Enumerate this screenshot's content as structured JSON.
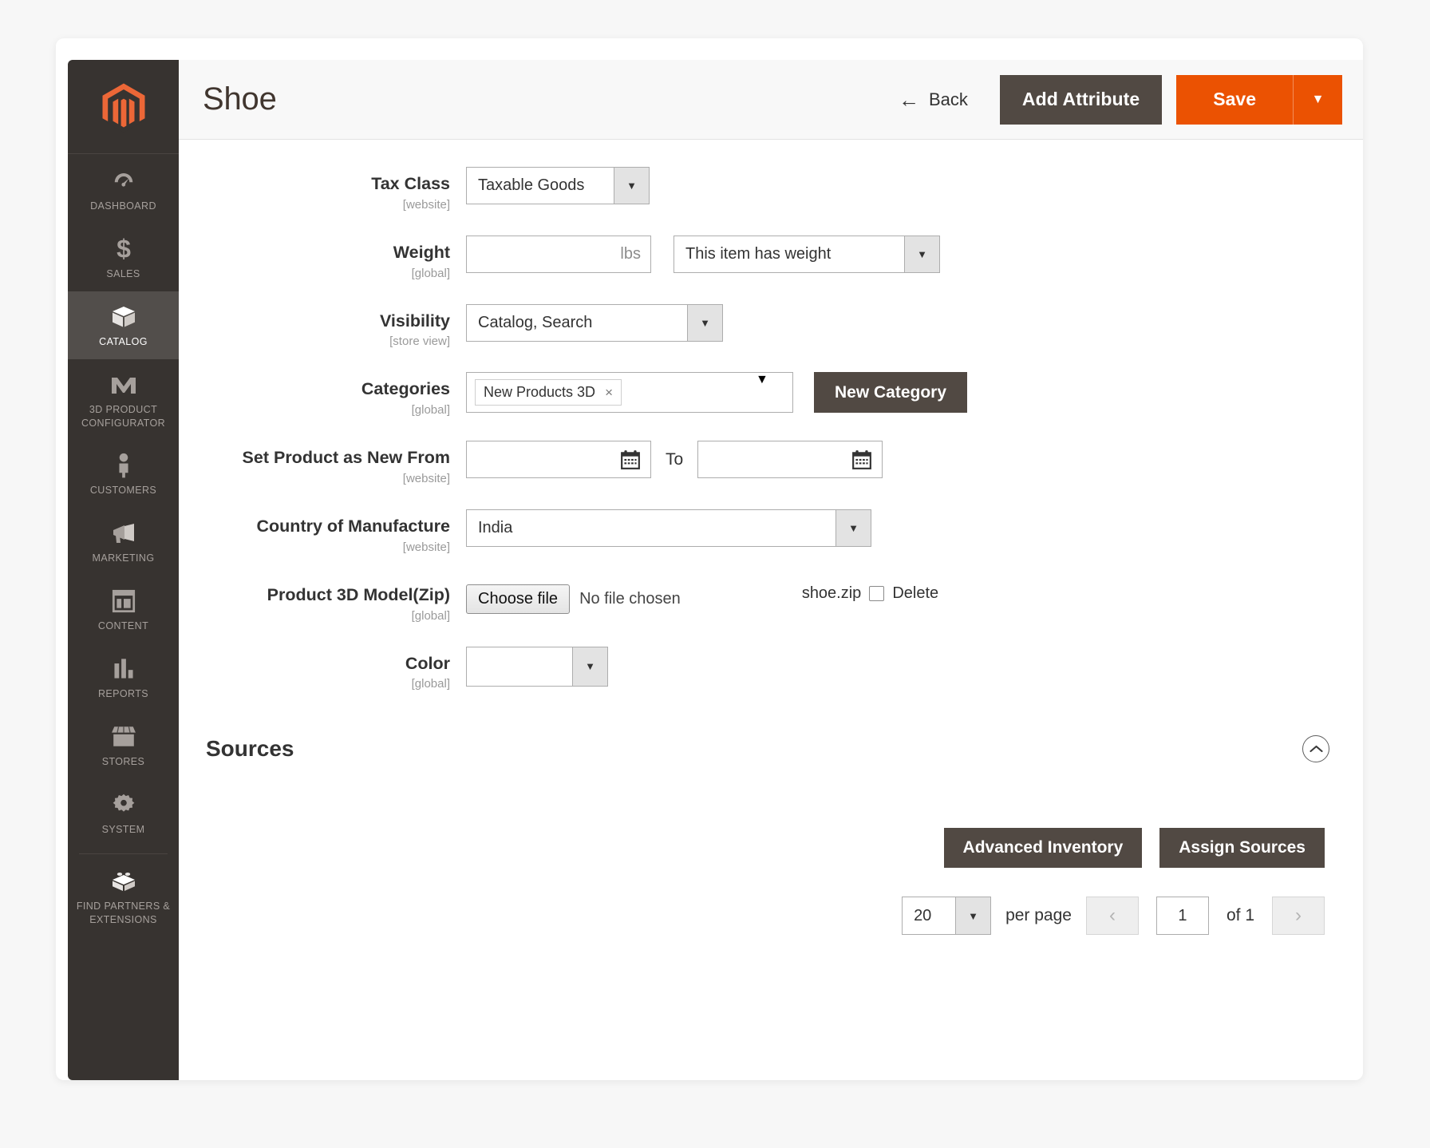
{
  "header": {
    "title": "Shoe",
    "back_label": "Back",
    "add_attribute_label": "Add Attribute",
    "save_label": "Save",
    "save_caret": "▼",
    "back_arrow": "←"
  },
  "colors": {
    "brand_orange": "#eb5202",
    "sidebar_dark": "#373330",
    "button_dark": "#514943"
  },
  "sidebar": {
    "logo": "magento-logo",
    "items": [
      {
        "label": "DASHBOARD",
        "icon": "dashboard-gauge-icon",
        "active": false
      },
      {
        "label": "SALES",
        "icon": "dollar-sign-icon",
        "active": false
      },
      {
        "label": "CATALOG",
        "icon": "box-icon",
        "active": true
      },
      {
        "label": "3D PRODUCT CONFIGURATOR",
        "icon": "configurator-icon",
        "active": false
      },
      {
        "label": "CUSTOMERS",
        "icon": "person-icon",
        "active": false
      },
      {
        "label": "MARKETING",
        "icon": "megaphone-icon",
        "active": false
      },
      {
        "label": "CONTENT",
        "icon": "layout-icon",
        "active": false
      },
      {
        "label": "REPORTS",
        "icon": "bar-chart-icon",
        "active": false
      },
      {
        "label": "STORES",
        "icon": "storefront-icon",
        "active": false
      },
      {
        "label": "SYSTEM",
        "icon": "gear-icon",
        "active": false
      },
      {
        "label": "FIND PARTNERS & EXTENSIONS",
        "icon": "lego-brick-icon",
        "active": false
      }
    ]
  },
  "form": {
    "tax_class": {
      "label": "Tax Class",
      "scope": "[website]",
      "value": "Taxable Goods",
      "caret": "▼"
    },
    "weight": {
      "label": "Weight",
      "scope": "[global]",
      "value": "",
      "unit": "lbs",
      "has_weight_value": "This item has weight",
      "caret": "▼"
    },
    "visibility": {
      "label": "Visibility",
      "scope": "[store view]",
      "value": "Catalog, Search",
      "caret": "▼"
    },
    "categories": {
      "label": "Categories",
      "scope": "[global]",
      "chips": [
        {
          "label": "New Products 3D",
          "remove": "×"
        }
      ],
      "caret": "▼",
      "new_category_label": "New Category"
    },
    "new_from": {
      "label": "Set Product as New From",
      "scope": "[website]",
      "from_value": "",
      "to_label": "To",
      "to_value": "",
      "calendar_icon": "calendar-icon"
    },
    "country": {
      "label": "Country of Manufacture",
      "scope": "[website]",
      "value": "India",
      "caret": "▼"
    },
    "model_zip": {
      "label": "Product 3D Model(Zip)",
      "scope": "[global]",
      "choose_file_label": "Choose file",
      "no_file_label": "No file chosen",
      "file_name": "shoe.zip",
      "delete_label": "Delete",
      "delete_checked": false
    },
    "color": {
      "label": "Color",
      "scope": "[global]",
      "value": "",
      "caret": "▼"
    }
  },
  "sources": {
    "title": "Sources",
    "toggle_icon": "chevron-up-icon",
    "advanced_inventory_label": "Advanced Inventory",
    "assign_sources_label": "Assign Sources",
    "pager": {
      "per_page_value": "20",
      "per_page_caret": "▼",
      "per_page_label": "per page",
      "prev_icon": "‹",
      "page_value": "1",
      "of_label": "of 1",
      "next_icon": "›"
    }
  }
}
